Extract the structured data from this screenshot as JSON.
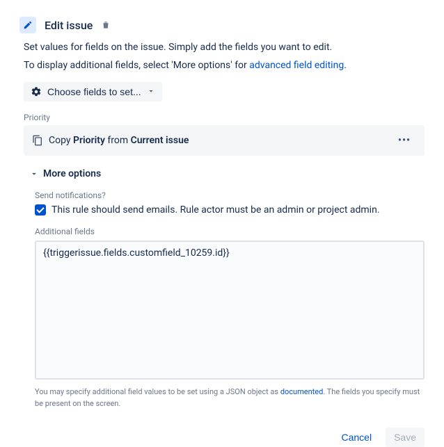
{
  "header": {
    "title": "Edit issue",
    "description": "Set values for fields on the issue. Simply add the fields you want to edit.",
    "sub_description_prefix": "To display additional fields, select 'More options' for ",
    "sub_description_link": "advanced field editing",
    "sub_description_suffix": "."
  },
  "choose_fields": {
    "label": "Choose fields to set..."
  },
  "priority_section": {
    "label": "Priority",
    "text_copy": "Copy ",
    "text_priority": "Priority",
    "text_from": " from ",
    "text_current": "Current issue"
  },
  "more_options": {
    "label": "More options"
  },
  "notifications": {
    "label": "Send notifications?",
    "checkbox_label": "This rule should send emails. Rule actor must be an admin or project admin."
  },
  "additional_fields": {
    "label": "Additional fields",
    "value": "{{triggerissue.fields.customfield_10259.id}}",
    "help_prefix": "You may specify additional field values to be set using a JSON object as ",
    "help_link": "documented",
    "help_suffix": ". The fields you specify must be present on the screen."
  },
  "footer": {
    "cancel": "Cancel",
    "save": "Save"
  }
}
